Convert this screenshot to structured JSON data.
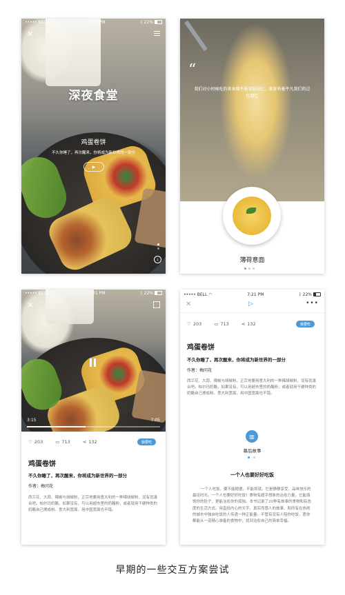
{
  "status_bar": {
    "carrier": "BELL",
    "time": "7:21 PM",
    "battery": "22%"
  },
  "screen1": {
    "brand": "深夜食堂",
    "dish_title": "鸡蛋卷饼",
    "dish_tagline": "不久你睡了，再次醒来，你将成为新世界的一部分"
  },
  "screen2": {
    "quote": "我们对小时候吃的美食都有着深刻记忆，美食有着平凡我们的过往回忆",
    "dish_name": "薄荷意面"
  },
  "screen3": {
    "progress_current": "3:15",
    "progress_total": "7:05",
    "progress_fraction": 0.44,
    "likes": "203",
    "comments": "713",
    "shares": "132",
    "button_label": "我要吃",
    "title": "鸡蛋卷饼",
    "subtitle": "不久你睡了，再次醒来，你将成为新世界的一部分",
    "author_label": "作者：",
    "author_name": "梅问花",
    "body": "西兰花、大蒜、辣椒与胡椒粉，正宗地要用意大利的一种辣胡椒粉，没有就凑合吧。帕尔玛奶酪，如果没有，可以用超市里的奶酪粉，或者就用干硬种类的奶酪自己擦成粉。意大利宽面，用中国宽面也不错。"
  },
  "screen4": {
    "likes": "203",
    "comments": "713",
    "shares": "132",
    "button_label": "我要吃",
    "title": "鸡蛋卷饼",
    "subtitle": "不久你睡了，再次醒来，你将成为新世界的一部分",
    "author_label": "作者：",
    "author_name": "梅问花",
    "body": "西兰花、大蒜、辣椒与胡椒粉，正宗地要用意大利的一种辣胡椒粉，没有就凑合吧。帕尔玛奶酪，如果没有，可以用超市里的奶酪粉，或者就用干硬种类的奶酪自己擦成粉。意大利宽面，用中国宽面也不错。",
    "story_label": "幕后故事",
    "story_heading": "一个人也要好好吃饭",
    "story_body": "一个人吃饭，要不能随便。不能将就。它是静静享受、品味快乐的最佳时光。一个人也要好好吃饭！食物有超乎想象的治愈力量，它能填饱你的肚子，更能治愈你的孤独。本书记录了20种有故事的食物和有态度的生活方式。用直抵内心的文字、真实而感人的故事、和所有在热闹的城市中独自吃饭的人传递一种正能量。不管有没有人陪你吃饭，愿你都能从一道精心准备的食物中，找到治愈自己的简单幸福。"
  },
  "footer_caption": "早期的一些交互方案尝试",
  "colors": {
    "accent_blue": "#4a9ad9",
    "text_dark": "#222222",
    "text_muted": "#777777"
  }
}
